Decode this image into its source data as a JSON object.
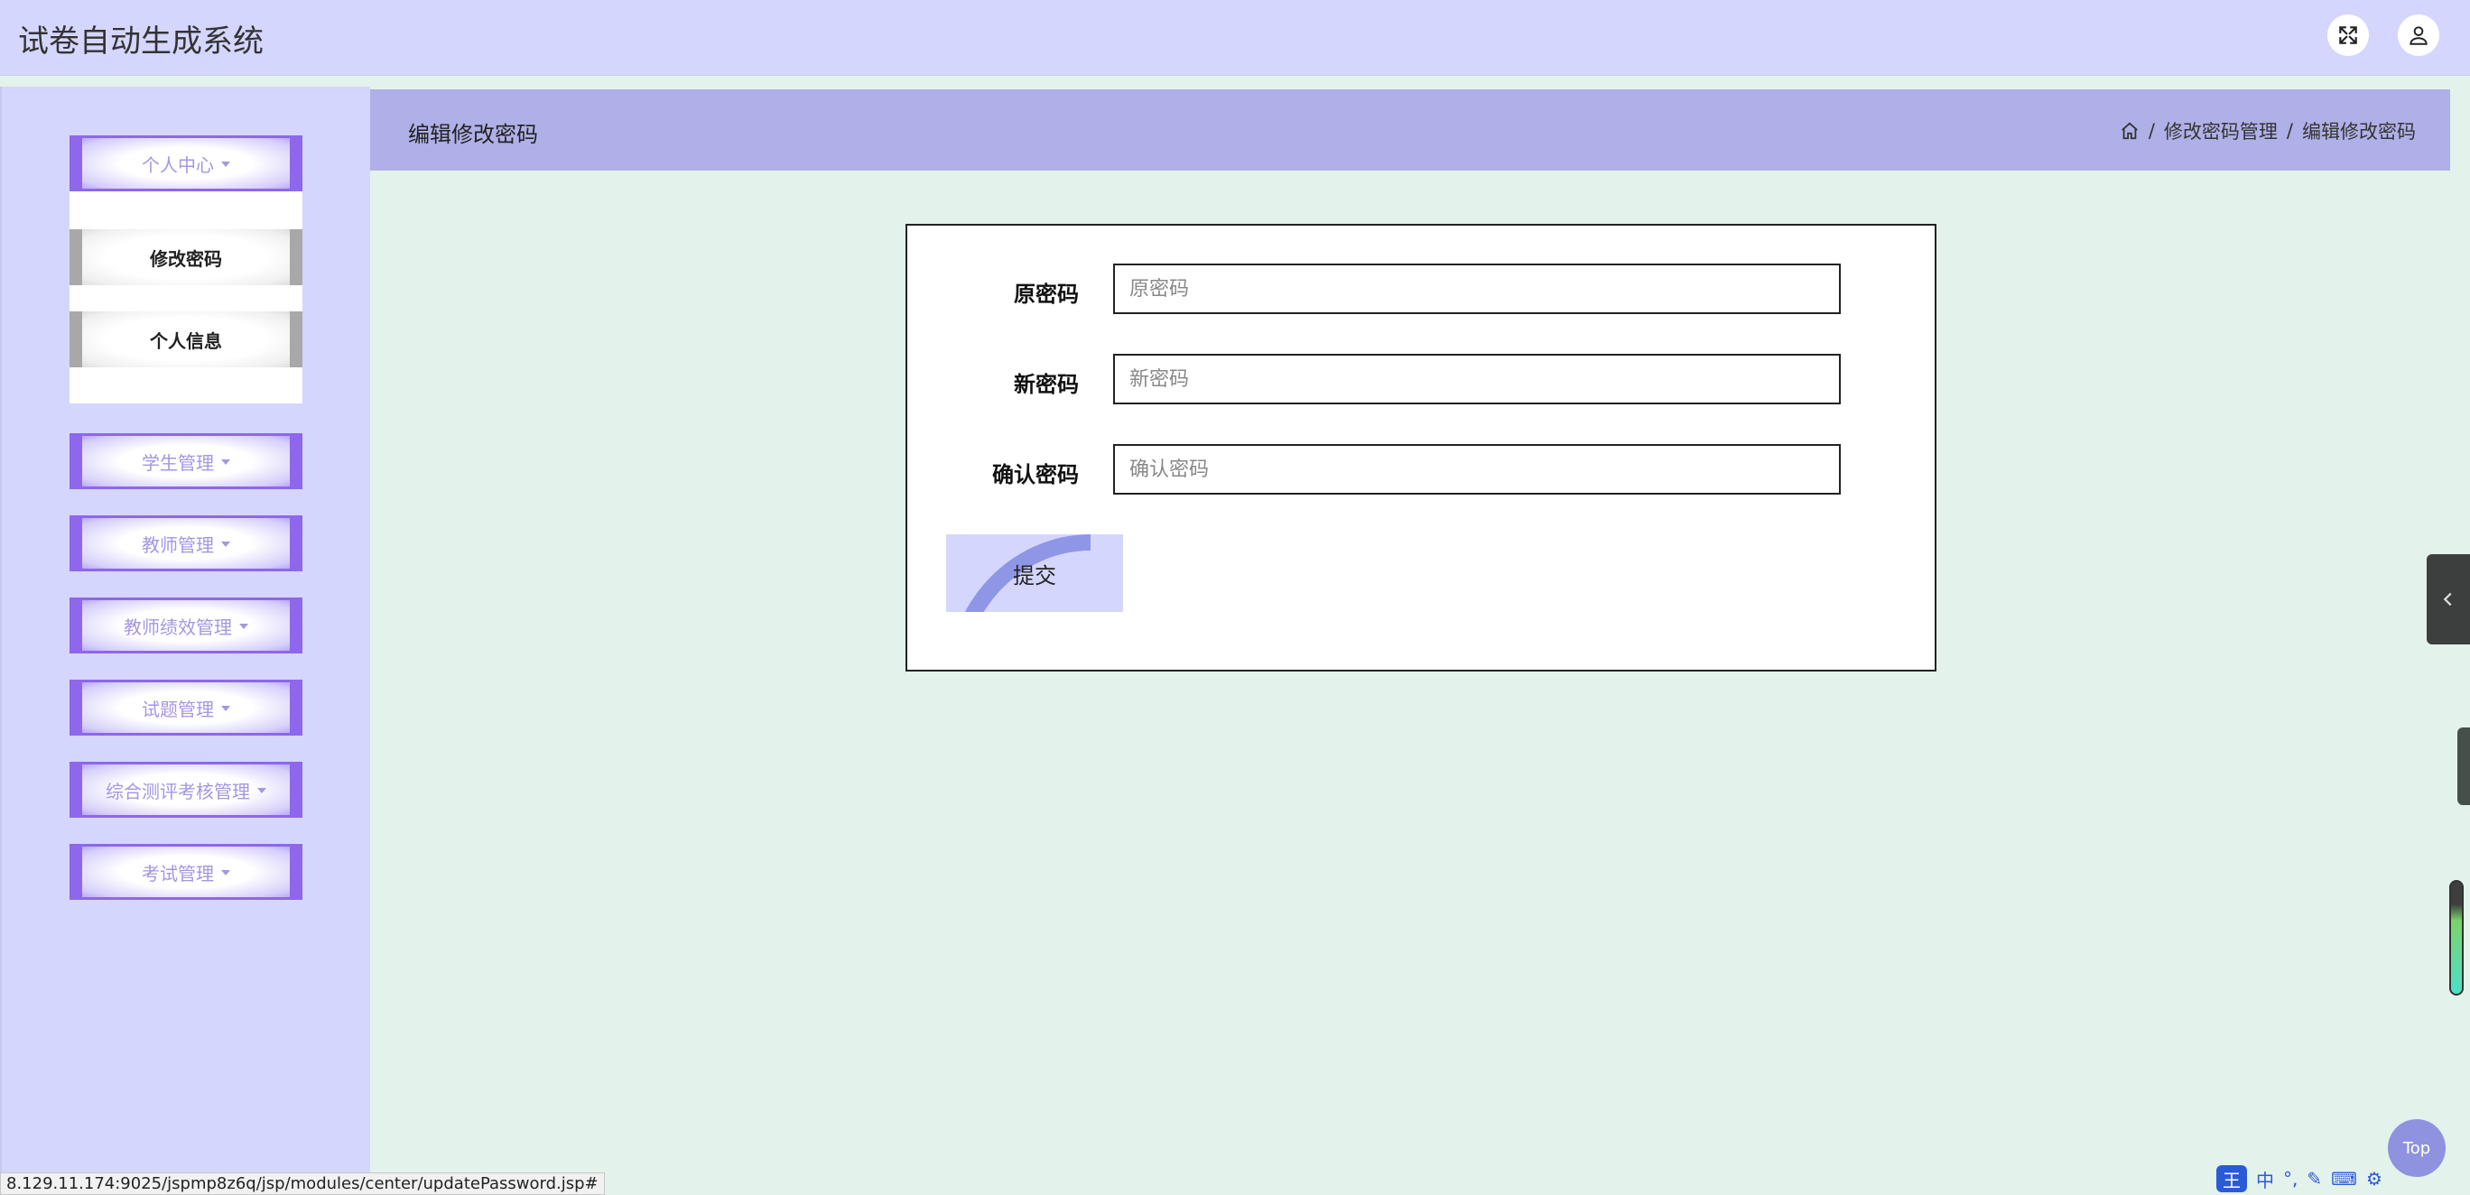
{
  "app": {
    "title": "试卷自动生成系统"
  },
  "topbar": {
    "icons": [
      "expand-icon",
      "user-icon"
    ]
  },
  "sidebar": {
    "groups": [
      {
        "label": "个人中心",
        "expanded": true,
        "items": [
          "修改密码",
          "个人信息"
        ]
      },
      {
        "label": "学生管理"
      },
      {
        "label": "教师管理"
      },
      {
        "label": "教师绩效管理"
      },
      {
        "label": "试题管理"
      },
      {
        "label": "综合测评考核管理"
      },
      {
        "label": "考试管理"
      }
    ]
  },
  "page": {
    "title": "编辑修改密码",
    "breadcrumb": [
      "修改密码管理",
      "编辑修改密码"
    ],
    "separator": "/"
  },
  "form": {
    "fields": [
      {
        "label": "原密码",
        "placeholder": "原密码",
        "value": ""
      },
      {
        "label": "新密码",
        "placeholder": "新密码",
        "value": ""
      },
      {
        "label": "确认密码",
        "placeholder": "确认密码",
        "value": ""
      }
    ],
    "submit_label": "提交"
  },
  "widgets": {
    "top_label": "Top"
  },
  "status": {
    "url": "8.129.11.174:9025/jspmp8z6q/jsp/modules/center/updatePassword.jsp#"
  },
  "ime": {
    "badge": "王",
    "lang": "中"
  },
  "colors": {
    "header_bg": "#d4d6fd",
    "menu_accent": "#8e67ec",
    "page_header_bg": "#afb0e7",
    "content_bg": "#e4f2ec"
  }
}
